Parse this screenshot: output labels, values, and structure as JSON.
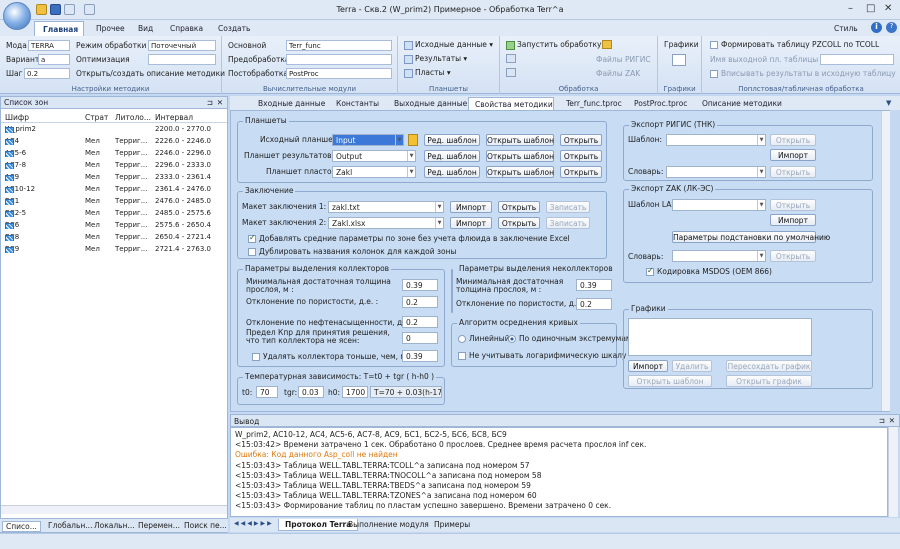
{
  "window": {
    "title": "Terra - Скв.2 (W_prim2) Примерное - Обработка Terr^a",
    "style_label": "Стиль"
  },
  "ribbon_tabs": [
    "Главная",
    "Прочее",
    "Вид",
    "Справка",
    "Создать"
  ],
  "ribbon": {
    "settings": {
      "model_label": "Мода",
      "model_value": "TERRA",
      "mode_label": "Режим обработки",
      "mode_value": "Поточечный",
      "variant_label": "Вариант",
      "variant_value": "а",
      "optimization_label": "Оптимизация",
      "step_label": "Шаг",
      "step_value": "0.2",
      "open_create_label": "Открыть/создать описание методики",
      "group_label": "Настройки методики"
    },
    "modules": {
      "core_label": "Основной",
      "core_value": "Terr_func",
      "pre_label": "Предобработка",
      "post_label": "Постобработка",
      "post_value": "PostProc",
      "group_label": "Вычислительные модули"
    },
    "plates": {
      "source": "Исходные данные",
      "results": "Результаты",
      "layers": "Пласты",
      "group_label": "Планшеты"
    },
    "processing": {
      "run": "Запустить обработку",
      "rigis_files": "Файлы РИГИС",
      "zak_files": "Файлы ZAK",
      "group_label": "Обработка"
    },
    "charts": {
      "label": "Графики",
      "group_label": "Графики"
    },
    "table": {
      "form_label": "Формировать таблицу PZCOLL по TCOLL",
      "output_name_label": "Имя выходной пл. таблицы",
      "write_label": "Вписывать результаты в исходную таблицу",
      "group_label": "Поплстовая/табличная обработка"
    }
  },
  "zones_panel": {
    "title": "Список зон",
    "columns": [
      "Шифр",
      "Страт",
      "Литоло...",
      "Интервал"
    ],
    "rows": [
      {
        "code": "W_prim2",
        "strat": "",
        "lith": "",
        "interval": "2200.0 - 2770.0",
        "icon": "well-icon"
      },
      {
        "code": "АС4",
        "strat": "Мел",
        "lith": "Терриг...",
        "interval": "2226.0 - 2246.0",
        "icon": "zone-icon"
      },
      {
        "code": "АС5-6",
        "strat": "Мел",
        "lith": "Терриг...",
        "interval": "2246.0 - 2296.0",
        "icon": "zone-icon"
      },
      {
        "code": "АС7-8",
        "strat": "Мел",
        "lith": "Терриг...",
        "interval": "2296.0 - 2333.0",
        "icon": "zone-icon"
      },
      {
        "code": "АС9",
        "strat": "Мел",
        "lith": "Терриг...",
        "interval": "2333.0 - 2361.4",
        "icon": "zone-icon"
      },
      {
        "code": "АС10-12",
        "strat": "Мел",
        "lith": "Терриг...",
        "interval": "2361.4 - 2476.0",
        "icon": "zone-icon"
      },
      {
        "code": "БС1",
        "strat": "Мел",
        "lith": "Терриг...",
        "interval": "2476.0 - 2485.0",
        "icon": "zone-icon"
      },
      {
        "code": "БС2-5",
        "strat": "Мел",
        "lith": "Терриг...",
        "interval": "2485.0 - 2575.6",
        "icon": "zone-icon"
      },
      {
        "code": "БС6",
        "strat": "Мел",
        "lith": "Терриг...",
        "interval": "2575.6 - 2650.4",
        "icon": "zone-icon"
      },
      {
        "code": "БС8",
        "strat": "Мел",
        "lith": "Терриг...",
        "interval": "2650.4 - 2721.4",
        "icon": "zone-icon"
      },
      {
        "code": "БС9",
        "strat": "Мел",
        "lith": "Терриг...",
        "interval": "2721.4 - 2763.0",
        "icon": "zone-icon"
      }
    ],
    "bottom_tabs": [
      "Списо...",
      "Глобальн...",
      "Локальн...",
      "Перемен...",
      "Поиск пе..."
    ]
  },
  "doc_tabs": [
    "Входные данные",
    "Константы",
    "Выходные данные",
    "Свойства методики",
    "Terr_func.tproc",
    "PostProc.tproc",
    "Описание методики"
  ],
  "active_doc_tab": "Свойства методики",
  "props": {
    "plates": {
      "title": "Планшеты",
      "rows": [
        {
          "label": "Исходный планшет:",
          "value": "Input"
        },
        {
          "label": "Планшет результатов:",
          "value": "Output"
        },
        {
          "label": "Планшет пластов:",
          "value": "Zakl"
        }
      ],
      "edit_btn": "Ред. шаблон",
      "open_tpl_btn": "Открыть шаблон",
      "open_btn": "Открыть"
    },
    "conclusion": {
      "title": "Заключение",
      "rows": [
        {
          "label": "Макет заключения 1:",
          "value": "zakl.txt"
        },
        {
          "label": "Макет заключения 2:",
          "value": "Zakl.xlsx"
        }
      ],
      "import_btn": "Импорт",
      "open_btn": "Открыть",
      "write_btn": "Записать",
      "check1": "Добавлять средние параметры по зоне без учета флюида в заключение Excel",
      "check2": "Дублировать названия колонок для каждой зоны"
    },
    "collectors": {
      "title": "Параметры выделения коллекторов",
      "min_thick_label": "Минимальная достаточная толщина прослоя, м :",
      "min_thick": "0.39",
      "porosity_label": "Отклонение по пористости, д.е. :",
      "porosity": "0.2",
      "oil_sat_label": "Отклонение по нефтенасыщенности, д.е. :",
      "oil_sat": "0.2",
      "kpr_label": "Предел Кпр для принятия решения, что тип коллектора не ясен:",
      "kpr": "0",
      "remove_label": "Удалять коллектора тоньше, чем, м:",
      "remove": "0.39"
    },
    "noncollectors": {
      "title": "Параметры выделения неколлекторов",
      "min_thick_label": "Минимальная достаточная толщина прослоя, м :",
      "min_thick": "0.39",
      "porosity_label": "Отклонение по пористости, д.е. :",
      "porosity": "0.2"
    },
    "averaging": {
      "title": "Алгоритм осреднения кривых",
      "linear": "Линейный",
      "extremes": "По одиночным экстремумам",
      "log_scale": "Не учитывать логарифмическую шкалу"
    },
    "temperature": {
      "title": "Температурная зависимость: T=t0 + tgr ( h-h0 )",
      "t0_label": "t0:",
      "t0": "70",
      "tgr_label": "tgr:",
      "tgr": "0.03",
      "h0_label": "h0:",
      "h0": "1700",
      "formula": "T=70 + 0.03(h-1700)"
    },
    "rigis": {
      "title": "Экспорт РИГИС (ТНК)",
      "template_label": "Шаблон:",
      "dict_label": "Словарь:",
      "open_btn": "Открыть",
      "import_btn": "Импорт"
    },
    "zak": {
      "title": "Экспорт ZAK (ЛК-ЭС)",
      "las_label": "Шаблон LAS:",
      "open_btn": "Открыть",
      "import_btn": "Импорт",
      "subst_btn": "Параметры подстановки по умолчанию",
      "dict_label": "Словарь:",
      "encoding": "Кодировка MSDOS (OEM 866)"
    },
    "charts": {
      "title": "Графики",
      "import_btn": "Импорт",
      "delete_btn": "Удалить",
      "resave_btn": "Пересохдать график",
      "open_tpl_btn": "Открыть шаблон",
      "open_chart_btn": "Открыть график"
    }
  },
  "output": {
    "title": "Вывод",
    "lines": [
      {
        "text": "W_prim2, АС10-12, АС4, АС5-6, АС7-8, АС9, БС1, БС2-5, БС6, БС8, БС9",
        "color": "#1e1e1e"
      },
      {
        "text": "<15:03:42> Времени затрачено 1 сек. Обработано 0 прослоев. Среднее время расчета прослоя inf сек.",
        "color": "#1e1e1e"
      },
      {
        "text": "Ошибка: Код данного Asp_coll не найден",
        "color": "#e07a10"
      },
      {
        "text": "<15:03:43> Таблица WELL.TABL.TERRA:TCOLL^a записана под номером 57",
        "color": "#1e1e1e"
      },
      {
        "text": "<15:03:43> Таблица WELL.TABL.TERRA:TNOCOLL^a записана под номером 58",
        "color": "#1e1e1e"
      },
      {
        "text": "<15:03:43> Таблица WELL.TABL.TERRA:TBEDS^a записана под номером 59",
        "color": "#1e1e1e"
      },
      {
        "text": "<15:03:43> Таблица WELL.TABL.TERRA:TZONES^a записана под номером 60",
        "color": "#1e1e1e"
      },
      {
        "text": "<15:03:43> Формирование таблиц по пластам успешно завершено. Времени затрачено 0 сек.",
        "color": "#1e1e1e"
      }
    ],
    "tabs": [
      "Протокол Terra",
      "Выполнение модуля",
      "Примеры"
    ]
  }
}
